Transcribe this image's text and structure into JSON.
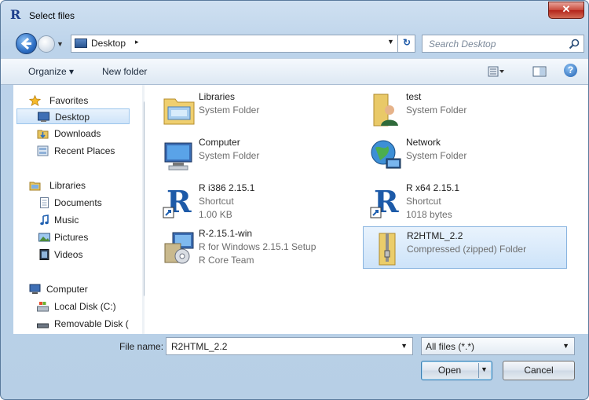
{
  "window": {
    "title": "Select files",
    "close_glyph": "✕"
  },
  "nav": {
    "address_path": "Desktop",
    "address_sep": "▸",
    "search_placeholder": "Search Desktop"
  },
  "toolbar": {
    "organize_label": "Organize ▾",
    "new_folder_label": "New folder"
  },
  "sidebar": {
    "favorites": [
      {
        "label": "Favorites",
        "icon": "star-icon"
      },
      {
        "label": "Desktop",
        "icon": "desktop-icon",
        "selected": true
      },
      {
        "label": "Downloads",
        "icon": "downloads-icon"
      },
      {
        "label": "Recent Places",
        "icon": "recent-places-icon"
      }
    ],
    "libraries": [
      {
        "label": "Libraries",
        "icon": "libraries-icon"
      },
      {
        "label": "Documents",
        "icon": "documents-icon"
      },
      {
        "label": "Music",
        "icon": "music-icon"
      },
      {
        "label": "Pictures",
        "icon": "pictures-icon"
      },
      {
        "label": "Videos",
        "icon": "videos-icon"
      }
    ],
    "computer": [
      {
        "label": "Computer",
        "icon": "computer-icon"
      },
      {
        "label": "Local Disk (C:)",
        "icon": "local-disk-icon"
      },
      {
        "label": "Removable Disk (",
        "icon": "removable-disk-icon"
      }
    ]
  },
  "files": [
    {
      "name": "Libraries",
      "line2": "System Folder",
      "line3": "",
      "icon": "libraries-folder-icon"
    },
    {
      "name": "test",
      "line2": "System Folder",
      "line3": "",
      "icon": "user-folder-icon"
    },
    {
      "name": "Computer",
      "line2": "System Folder",
      "line3": "",
      "icon": "computer-icon"
    },
    {
      "name": "Network",
      "line2": "System Folder",
      "line3": "",
      "icon": "network-icon"
    },
    {
      "name": "R i386 2.15.1",
      "line2": "Shortcut",
      "line3": "1.00 KB",
      "icon": "r-shortcut-icon"
    },
    {
      "name": "R x64 2.15.1",
      "line2": "Shortcut",
      "line3": "1018 bytes",
      "icon": "r-shortcut-icon"
    },
    {
      "name": "R-2.15.1-win",
      "line2": "R for Windows 2.15.1 Setup",
      "line3": "R Core Team",
      "icon": "installer-icon"
    },
    {
      "name": "R2HTML_2.2",
      "line2": "Compressed (zipped) Folder",
      "line3": "",
      "icon": "zip-folder-icon",
      "selected": true
    }
  ],
  "footer": {
    "file_name_label": "File name:",
    "file_name_value": "R2HTML_2.2",
    "file_type_value": "All files (*.*)",
    "open_label": "Open",
    "cancel_label": "Cancel"
  }
}
